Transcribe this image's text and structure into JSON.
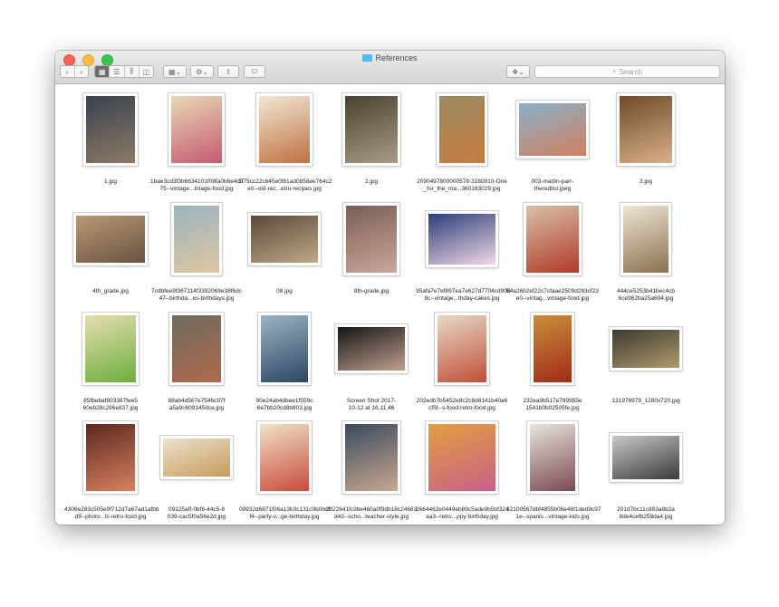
{
  "window": {
    "title": "References",
    "search_placeholder": "Search",
    "nav": {
      "back": "‹",
      "forward": "›"
    },
    "view_modes": [
      "icon-view",
      "list-view",
      "column-view",
      "cover-flow-view"
    ],
    "active_view": "icon-view"
  },
  "files": [
    {
      "name": "1.jpg",
      "c1": "#3a4150",
      "c2": "#8c7a66"
    },
    {
      "name": "1bae3cd3f3b6634101f08fa0b6e4c075--vintage...intage-food.jpg",
      "c1": "#e9d8b6",
      "c2": "#c45a70"
    },
    {
      "name": "1f75cc22c645e0f81ad0858ee764c2e0--old-rec...etro-recipes.jpg",
      "c1": "#f0e8d6",
      "c2": "#c07040"
    },
    {
      "name": "2.jpg",
      "c1": "#4a4130",
      "c2": "#a99c86"
    },
    {
      "name": "2090497800000578-3280910-One_for_the_ma...360183029.jpg",
      "c1": "#9a8a62",
      "c2": "#c67c40"
    },
    {
      "name": "003-martin-parr-theredlist.jpeg",
      "c1": "#8ab0c8",
      "c2": "#d08060"
    },
    {
      "name": "3.jpg",
      "c1": "#6e4a2a",
      "c2": "#d9b08a"
    },
    {
      "name": "4th_grade.jpg",
      "c1": "#b89a74",
      "c2": "#6a5242"
    },
    {
      "name": "7cdbfee9f367114f3392069e38f6dc47--birthda...es-birthdays.jpg",
      "c1": "#9ab4c0",
      "c2": "#e0c6a0"
    },
    {
      "name": "08.jpg",
      "c1": "#5a4a3a",
      "c2": "#c0a888"
    },
    {
      "name": "8th-grade.jpg",
      "c1": "#7a5e56",
      "c2": "#c8a89a"
    },
    {
      "name": "35afa7e7ef897ea7e627d7704cd9008c--vintage...thday-cakes.jpg",
      "c1": "#2a3e78",
      "c2": "#f2d8e6"
    },
    {
      "name": "54a26b2ef22c7cfaae2509d283cf23e0--vintag...vintage-food.jpg",
      "c1": "#d8c0a8",
      "c2": "#b03a2a"
    },
    {
      "name": "444ce5253b41bec4cb6ce962ba25a694.jpg",
      "c1": "#eee6d4",
      "c2": "#8a7050"
    },
    {
      "name": "85fbebaf803387fee560eb28c296e837.jpg",
      "c1": "#e6ddb0",
      "c2": "#6cae3c"
    },
    {
      "name": "88ab4d567e7546c97fa5a9c609145dce.jpg",
      "c1": "#6e6a60",
      "c2": "#b06a4a"
    },
    {
      "name": "90e24ab4dbee1f559c6a7bb20cd8b803.jpg",
      "c1": "#9ab4c6",
      "c2": "#2c4660"
    },
    {
      "name": "Screen Shot 2017-10-12 at 16.11.46",
      "c1": "#151515",
      "c2": "#c0a090"
    },
    {
      "name": "202edb7b5452e8c2c8d8141b40a6cf5f--s-food-retro-food.jpg",
      "c1": "#e6d8c8",
      "c2": "#c05038"
    },
    {
      "name": "232ea9b517e789955e1541b0b02505fe.jpg",
      "c1": "#c8903a",
      "c2": "#a02a1a"
    },
    {
      "name": "131976979_1280x720.jpg",
      "c1": "#3c3a32",
      "c2": "#b09a6a"
    },
    {
      "name": "4306e283c505e9f712d7a67ad1afbbd9--photo...ls-retro-food.jpg",
      "c1": "#5a2a1e",
      "c2": "#d88060"
    },
    {
      "name": "09125aff-0bf8-44c5-8039-cac5f0a56e2d.jpg",
      "c1": "#eae2d0",
      "c2": "#c89a5a"
    },
    {
      "name": "09932d6871f06a13b3c131c9b0bcff4--party-v...ge-birthday.jpg",
      "c1": "#f0e2c8",
      "c2": "#c84a3a"
    },
    {
      "name": "2822641fc9be460a0f9db18c24683d43--scho...teacher-style.jpg",
      "c1": "#3a4a5e",
      "c2": "#c8a890"
    },
    {
      "name": "2664462e0449eb89c5ade9b5bf324aa3--retro...ppy-birthday.jpg",
      "c1": "#e0a040",
      "c2": "#c8608a"
    },
    {
      "name": "32100567dbf4855b06e46f1ded9c971e--spanis...vintage-kids.jpg",
      "c1": "#e8e4dc",
      "c2": "#7a4a52"
    },
    {
      "name": "201d7bc11c893a8b2a8de4cefb258da4.jpg",
      "c1": "#c8c8c8",
      "c2": "#3a3a3a"
    }
  ]
}
